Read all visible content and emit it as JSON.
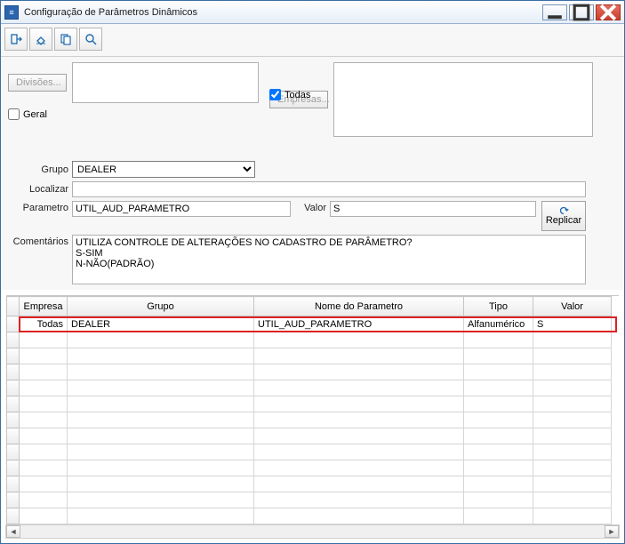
{
  "window": {
    "title": "Configuração de Parâmetros Dinâmicos",
    "icon_label": "≡"
  },
  "toolbar": {
    "icons": [
      "export-icon",
      "erase-icon",
      "copy-icon",
      "search-icon"
    ]
  },
  "form": {
    "divisoes_btn": "Divisões...",
    "empresas_btn": "Empresas...",
    "geral_label": "Geral",
    "todas_label": "Todas",
    "todas_checked": true,
    "grupo_label": "Grupo",
    "grupo_value": "DEALER",
    "localizar_label": "Localizar",
    "localizar_value": "",
    "parametro_label": "Parametro",
    "parametro_value": "UTIL_AUD_PARAMETRO",
    "valor_label": "Valor",
    "valor_value": "S",
    "replicar_label": "Replicar",
    "comentarios_label": "Comentários",
    "comentarios_value": "UTILIZA CONTROLE DE ALTERAÇÕES NO CADASTRO DE PARÂMETRO?\nS-SIM\nN-NÃO(PADRÃO)"
  },
  "grid": {
    "columns": [
      "Empresa",
      "Grupo",
      "Nome do Parametro",
      "Tipo",
      "Valor"
    ],
    "rows": [
      {
        "empresa": "Todas",
        "grupo": "DEALER",
        "nome": "UTIL_AUD_PARAMETRO",
        "tipo": "Alfanumérico",
        "valor": "S"
      }
    ],
    "empty_rows": 12
  }
}
